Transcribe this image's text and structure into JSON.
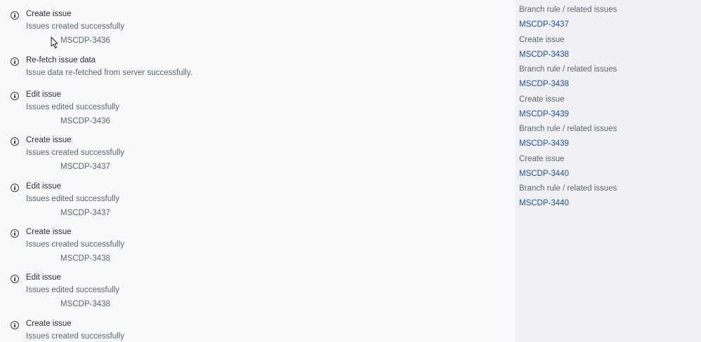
{
  "log_entries": [
    {
      "title": "Create issue",
      "message": "Issues created successfully",
      "issue_key": "MSCDP-3436"
    },
    {
      "title": "Re-fetch issue data",
      "message": "Issue data re-fetched from server successfully.",
      "issue_key": null
    },
    {
      "title": "Edit issue",
      "message": "Issues edited successfully",
      "issue_key": "MSCDP-3436"
    },
    {
      "title": "Create issue",
      "message": "Issues created successfully",
      "issue_key": "MSCDP-3437"
    },
    {
      "title": "Edit issue",
      "message": "Issues edited successfully",
      "issue_key": "MSCDP-3437"
    },
    {
      "title": "Create issue",
      "message": "Issues created successfully",
      "issue_key": "MSCDP-3438"
    },
    {
      "title": "Edit issue",
      "message": "Issues edited successfully",
      "issue_key": "MSCDP-3438"
    },
    {
      "title": "Create issue",
      "message": "Issues created successfully",
      "issue_key": null
    }
  ],
  "related": [
    {
      "label": "Branch rule / related issues",
      "link": "MSCDP-3437"
    },
    {
      "label": "Create issue",
      "link": "MSCDP-3438"
    },
    {
      "label": "Branch rule / related issues",
      "link": "MSCDP-3438"
    },
    {
      "label": "Create issue",
      "link": "MSCDP-3439"
    },
    {
      "label": "Branch rule / related issues",
      "link": "MSCDP-3439"
    },
    {
      "label": "Create issue",
      "link": "MSCDP-3440"
    },
    {
      "label": "Branch rule / related issues",
      "link": "MSCDP-3440"
    }
  ],
  "colors": {
    "link": "#1f4fa8",
    "text": "#2b2f36",
    "muted": "#5e6570",
    "panel": "#f0f1f4"
  }
}
